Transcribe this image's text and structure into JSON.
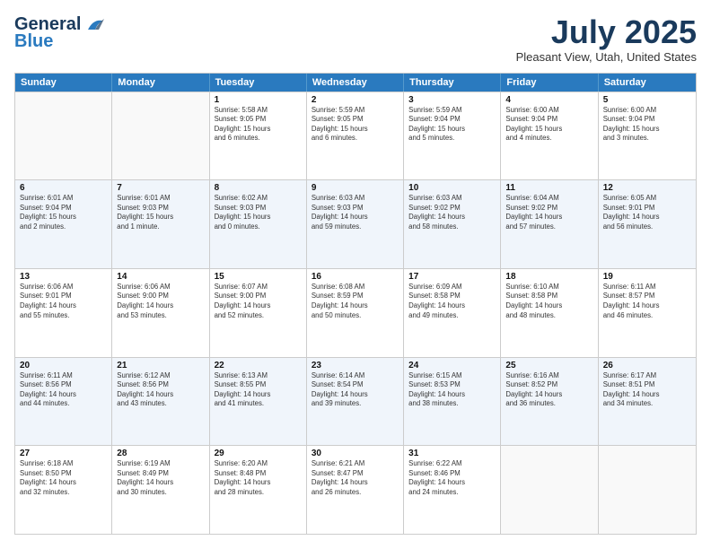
{
  "header": {
    "logo_line1": "General",
    "logo_line2": "Blue",
    "month": "July 2025",
    "location": "Pleasant View, Utah, United States"
  },
  "weekdays": [
    "Sunday",
    "Monday",
    "Tuesday",
    "Wednesday",
    "Thursday",
    "Friday",
    "Saturday"
  ],
  "rows": [
    [
      {
        "day": "",
        "info": ""
      },
      {
        "day": "",
        "info": ""
      },
      {
        "day": "1",
        "info": "Sunrise: 5:58 AM\nSunset: 9:05 PM\nDaylight: 15 hours\nand 6 minutes."
      },
      {
        "day": "2",
        "info": "Sunrise: 5:59 AM\nSunset: 9:05 PM\nDaylight: 15 hours\nand 6 minutes."
      },
      {
        "day": "3",
        "info": "Sunrise: 5:59 AM\nSunset: 9:04 PM\nDaylight: 15 hours\nand 5 minutes."
      },
      {
        "day": "4",
        "info": "Sunrise: 6:00 AM\nSunset: 9:04 PM\nDaylight: 15 hours\nand 4 minutes."
      },
      {
        "day": "5",
        "info": "Sunrise: 6:00 AM\nSunset: 9:04 PM\nDaylight: 15 hours\nand 3 minutes."
      }
    ],
    [
      {
        "day": "6",
        "info": "Sunrise: 6:01 AM\nSunset: 9:04 PM\nDaylight: 15 hours\nand 2 minutes."
      },
      {
        "day": "7",
        "info": "Sunrise: 6:01 AM\nSunset: 9:03 PM\nDaylight: 15 hours\nand 1 minute."
      },
      {
        "day": "8",
        "info": "Sunrise: 6:02 AM\nSunset: 9:03 PM\nDaylight: 15 hours\nand 0 minutes."
      },
      {
        "day": "9",
        "info": "Sunrise: 6:03 AM\nSunset: 9:03 PM\nDaylight: 14 hours\nand 59 minutes."
      },
      {
        "day": "10",
        "info": "Sunrise: 6:03 AM\nSunset: 9:02 PM\nDaylight: 14 hours\nand 58 minutes."
      },
      {
        "day": "11",
        "info": "Sunrise: 6:04 AM\nSunset: 9:02 PM\nDaylight: 14 hours\nand 57 minutes."
      },
      {
        "day": "12",
        "info": "Sunrise: 6:05 AM\nSunset: 9:01 PM\nDaylight: 14 hours\nand 56 minutes."
      }
    ],
    [
      {
        "day": "13",
        "info": "Sunrise: 6:06 AM\nSunset: 9:01 PM\nDaylight: 14 hours\nand 55 minutes."
      },
      {
        "day": "14",
        "info": "Sunrise: 6:06 AM\nSunset: 9:00 PM\nDaylight: 14 hours\nand 53 minutes."
      },
      {
        "day": "15",
        "info": "Sunrise: 6:07 AM\nSunset: 9:00 PM\nDaylight: 14 hours\nand 52 minutes."
      },
      {
        "day": "16",
        "info": "Sunrise: 6:08 AM\nSunset: 8:59 PM\nDaylight: 14 hours\nand 50 minutes."
      },
      {
        "day": "17",
        "info": "Sunrise: 6:09 AM\nSunset: 8:58 PM\nDaylight: 14 hours\nand 49 minutes."
      },
      {
        "day": "18",
        "info": "Sunrise: 6:10 AM\nSunset: 8:58 PM\nDaylight: 14 hours\nand 48 minutes."
      },
      {
        "day": "19",
        "info": "Sunrise: 6:11 AM\nSunset: 8:57 PM\nDaylight: 14 hours\nand 46 minutes."
      }
    ],
    [
      {
        "day": "20",
        "info": "Sunrise: 6:11 AM\nSunset: 8:56 PM\nDaylight: 14 hours\nand 44 minutes."
      },
      {
        "day": "21",
        "info": "Sunrise: 6:12 AM\nSunset: 8:56 PM\nDaylight: 14 hours\nand 43 minutes."
      },
      {
        "day": "22",
        "info": "Sunrise: 6:13 AM\nSunset: 8:55 PM\nDaylight: 14 hours\nand 41 minutes."
      },
      {
        "day": "23",
        "info": "Sunrise: 6:14 AM\nSunset: 8:54 PM\nDaylight: 14 hours\nand 39 minutes."
      },
      {
        "day": "24",
        "info": "Sunrise: 6:15 AM\nSunset: 8:53 PM\nDaylight: 14 hours\nand 38 minutes."
      },
      {
        "day": "25",
        "info": "Sunrise: 6:16 AM\nSunset: 8:52 PM\nDaylight: 14 hours\nand 36 minutes."
      },
      {
        "day": "26",
        "info": "Sunrise: 6:17 AM\nSunset: 8:51 PM\nDaylight: 14 hours\nand 34 minutes."
      }
    ],
    [
      {
        "day": "27",
        "info": "Sunrise: 6:18 AM\nSunset: 8:50 PM\nDaylight: 14 hours\nand 32 minutes."
      },
      {
        "day": "28",
        "info": "Sunrise: 6:19 AM\nSunset: 8:49 PM\nDaylight: 14 hours\nand 30 minutes."
      },
      {
        "day": "29",
        "info": "Sunrise: 6:20 AM\nSunset: 8:48 PM\nDaylight: 14 hours\nand 28 minutes."
      },
      {
        "day": "30",
        "info": "Sunrise: 6:21 AM\nSunset: 8:47 PM\nDaylight: 14 hours\nand 26 minutes."
      },
      {
        "day": "31",
        "info": "Sunrise: 6:22 AM\nSunset: 8:46 PM\nDaylight: 14 hours\nand 24 minutes."
      },
      {
        "day": "",
        "info": ""
      },
      {
        "day": "",
        "info": ""
      }
    ]
  ]
}
